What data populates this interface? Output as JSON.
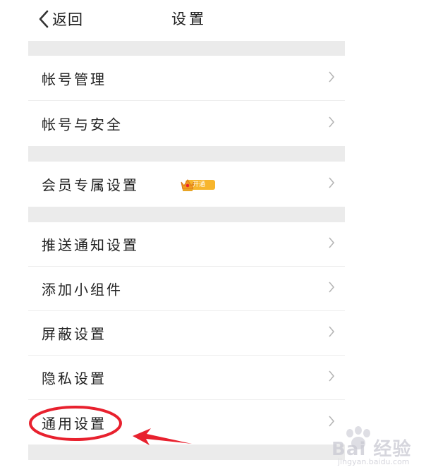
{
  "header": {
    "back_label": "返回",
    "title": "设置"
  },
  "groups": [
    {
      "items": [
        {
          "label": "帐号管理"
        },
        {
          "label": "帐号与安全"
        }
      ]
    },
    {
      "items": [
        {
          "label": "会员专属设置",
          "badge": "开通"
        }
      ]
    },
    {
      "items": [
        {
          "label": "推送通知设置"
        },
        {
          "label": "添加小组件"
        },
        {
          "label": "屏蔽设置"
        },
        {
          "label": "隐私设置"
        },
        {
          "label": "通用设置"
        }
      ]
    }
  ],
  "annotation": {
    "highlight_color": "#e8212e",
    "target_item": "通用设置"
  },
  "watermark": {
    "text": "Bai 经验",
    "subtext": "jingyan.baidu.com"
  },
  "colors": {
    "divider": "#ebebeb",
    "chevron": "#b5b5b5",
    "vip_badge": "#f7b52c"
  }
}
